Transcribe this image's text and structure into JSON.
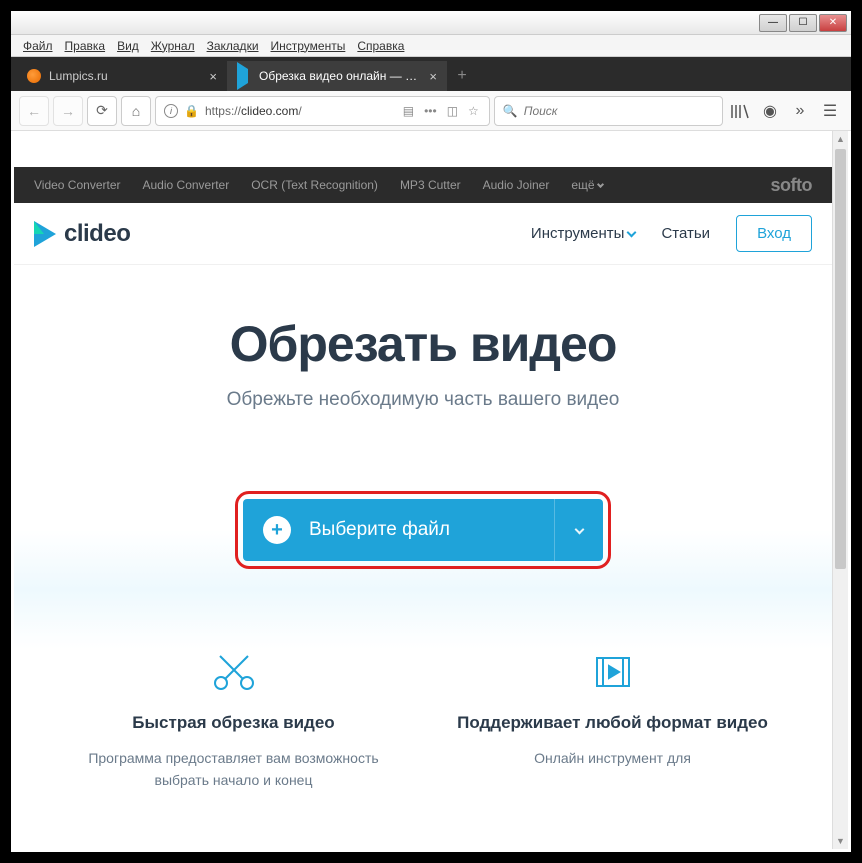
{
  "window_controls": {
    "min": "—",
    "max": "☐",
    "close": "✕"
  },
  "menu": [
    "Файл",
    "Правка",
    "Вид",
    "Журнал",
    "Закладки",
    "Инструменты",
    "Справка"
  ],
  "tabs": [
    {
      "label": "Lumpics.ru",
      "active": false,
      "icon": "orange"
    },
    {
      "label": "Обрезка видео онлайн — Обр",
      "active": true,
      "icon": "play"
    }
  ],
  "new_tab": "+",
  "url": {
    "scheme": "https://",
    "domain": "clideo.com",
    "path": "/"
  },
  "search_placeholder": "Поиск",
  "softo": {
    "links": [
      "Video Converter",
      "Audio Converter",
      "OCR (Text Recognition)",
      "MP3 Cutter",
      "Audio Joiner"
    ],
    "more": "ещё",
    "brand": "softo"
  },
  "clideo": {
    "brand": "clideo",
    "nav_tools": "Инструменты",
    "nav_articles": "Статьи",
    "login": "Вход"
  },
  "hero": {
    "title": "Обрезать видео",
    "subtitle": "Обрежьте необходимую часть вашего видео"
  },
  "cta": {
    "label": "Выберите файл"
  },
  "features": [
    {
      "title": "Быстрая обрезка видео",
      "desc": "Программа предоставляет вам возможность выбрать начало и конец"
    },
    {
      "title": "Поддерживает любой формат видео",
      "desc": "Онлайн инструмент для"
    }
  ]
}
